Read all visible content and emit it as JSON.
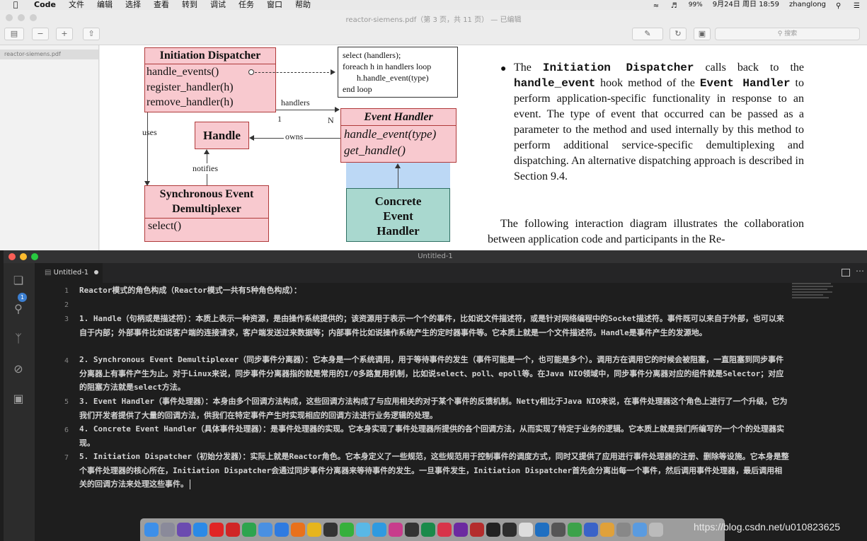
{
  "menubar": {
    "app_name": "Code",
    "menus": [
      "文件",
      "编辑",
      "选择",
      "查看",
      "转到",
      "调试",
      "任务",
      "窗口",
      "帮助"
    ],
    "battery": "99%",
    "datetime": "9月24日 周日 18:59",
    "user": "zhanglong"
  },
  "preview": {
    "title": "reactor-siemens.pdf（第 3 页，共 11 页） — 已编辑",
    "search_placeholder": "搜索",
    "sidebar_file": "reactor-siemens.pdf",
    "diagram": {
      "dispatcher_title": "Initiation Dispatcher",
      "dispatcher_methods": [
        "handle_events()",
        "register_handler(h)",
        "remove_handler(h)"
      ],
      "note_lines": [
        "select (handlers);",
        "foreach h in handlers loop",
        "h.handle_event(type)",
        "end loop"
      ],
      "handlers_label": "handlers",
      "mult_1": "1",
      "mult_n": "N",
      "event_handler_title": "Event Handler",
      "event_handler_methods": [
        "handle_event(type)",
        "get_handle()"
      ],
      "handle_title": "Handle",
      "owns_label": "owns",
      "uses_label": "uses",
      "notifies_label": "notifies",
      "demux_title_1": "Synchronous Event",
      "demux_title_2": "Demultiplexer",
      "demux_method": "select()",
      "concrete_1": "Concrete",
      "concrete_2": "Event",
      "concrete_3": "Handler"
    },
    "bullet": {
      "p1a": "The ",
      "p1_mono1": "Initiation Dispatcher",
      "p1b": " calls back to the ",
      "p1_mono2": "handle_event",
      "p1c": " hook method of the ",
      "p1_mono3": "Event Handler",
      "p1d": " to perform application-specific functionality in response to an event. The type of event that occurred can be passed as a parameter to the method and used internally by this method to perform additional service-specific demultiplexing and dispatching. An alternative dispatching approach is described in Section 9.4."
    },
    "para2": "The following interaction diagram illustrates the collaboration between application code and participants in the Re-"
  },
  "vscode": {
    "window_title": "Untitled-1",
    "tab_label": "Untitled-1",
    "badge": "1",
    "lines": [
      {
        "num": "1",
        "text": "Reactor模式的角色构成（Reactor模式一共有5种角色构成）："
      },
      {
        "num": "2",
        "text": ""
      },
      {
        "num": "3",
        "text": "1. Handle（句柄或是描述符）：本质上表示一种资源，是由操作系统提供的；该资源用于表示一个个的事件，比如说文件描述符，或是针对网络编程中的Socket描述符。事件既可以来自于外部，也可以来自于内部；外部事件比如说客户端的连接请求，客户端发送过来数据等；内部事件比如说操作系统产生的定时器事件等。它本质上就是一个文件描述符。Handle是事件产生的发源地。"
      },
      {
        "num": "4",
        "text": "2. Synchronous Event Demultiplexer（同步事件分离器）：它本身是一个系统调用，用于等待事件的发生（事件可能是一个，也可能是多个）。调用方在调用它的时候会被阻塞，一直阻塞到同步事件分离器上有事件产生为止。对于Linux来说，同步事件分离器指的就是常用的I/O多路复用机制，比如说select、poll、epoll等。在Java NIO领域中，同步事件分离器对应的组件就是Selector；对应的阻塞方法就是select方法。"
      },
      {
        "num": "5",
        "text": "3. Event Handler（事件处理器）：本身由多个回调方法构成，这些回调方法构成了与应用相关的对于某个事件的反馈机制。Netty相比于Java NIO来说，在事件处理器这个角色上进行了一个升级，它为我们开发者提供了大量的回调方法，供我们在特定事件产生时实现相应的回调方法进行业务逻辑的处理。"
      },
      {
        "num": "6",
        "text": "4. Concrete Event Handler（具体事件处理器）：是事件处理器的实现。它本身实现了事件处理器所提供的各个回调方法，从而实现了特定于业务的逻辑。它本质上就是我们所编写的一个个的处理器实现。"
      },
      {
        "num": "7",
        "text": "5. Initiation Dispatcher（初始分发器）：实际上就是Reactor角色。它本身定义了一些规范，这些规范用于控制事件的调度方式，同时又提供了应用进行事件处理器的注册、删除等设施。它本身是整个事件处理器的核心所在，Initiation Dispatcher会通过同步事件分离器来等待事件的发生。一旦事件发生，Initiation Dispatcher首先会分离出每一个事件，然后调用事件处理器，最后调用相关的回调方法来处理这些事件。"
      }
    ]
  },
  "watermark": "https://blog.csdn.net/u010823625",
  "colors": {
    "uml_pink": "#f8c9cf",
    "uml_teal": "#a9d8cf",
    "uml_blue": "#bcd8f5",
    "editor_bg": "#1e1e1e",
    "activity_bg": "#2c2c2c"
  }
}
